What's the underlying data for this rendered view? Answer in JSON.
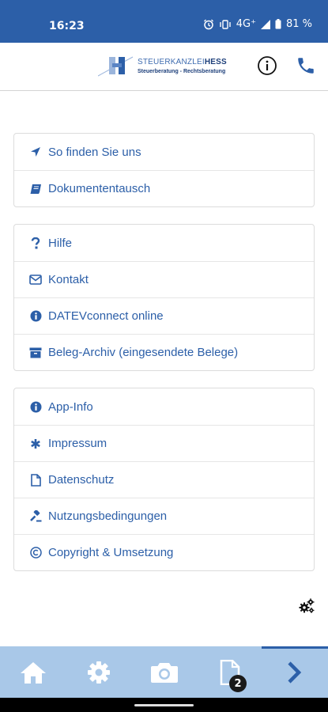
{
  "status_bar": {
    "time": "16:23",
    "network": "4G⁺",
    "battery": "81 %"
  },
  "header": {
    "logo_line1_a": "STEUERKANZLEI",
    "logo_line1_b": "HESS",
    "logo_line2": "Steuerberatung - Rechtsberatung"
  },
  "menu": {
    "group1": [
      {
        "label": "So finden Sie uns",
        "icon": "location-arrow-icon"
      },
      {
        "label": "Dokumententausch",
        "icon": "book-icon"
      }
    ],
    "group2": [
      {
        "label": "Hilfe",
        "icon": "question-icon"
      },
      {
        "label": "Kontakt",
        "icon": "envelope-icon"
      },
      {
        "label": "DATEVconnect online",
        "icon": "info-circle-icon"
      },
      {
        "label": "Beleg-Archiv (eingesendete Belege)",
        "icon": "archive-icon"
      }
    ],
    "group3": [
      {
        "label": "App-Info",
        "icon": "info-circle-icon"
      },
      {
        "label": "Impressum",
        "icon": "asterisk-icon"
      },
      {
        "label": "Datenschutz",
        "icon": "file-icon"
      },
      {
        "label": "Nutzungsbedingungen",
        "icon": "gavel-icon"
      },
      {
        "label": "Copyright & Umsetzung",
        "icon": "copyright-icon"
      }
    ]
  },
  "bottom_nav": {
    "documents_badge": "2"
  },
  "colors": {
    "accent": "#2c5fa8",
    "status_bar": "#2c5fa8",
    "bottom_nav": "#a9c8e8"
  }
}
